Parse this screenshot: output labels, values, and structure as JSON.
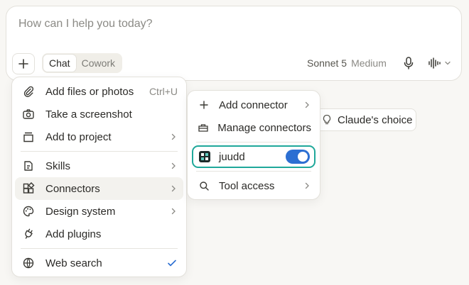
{
  "composer": {
    "placeholder": "How can I help you today?",
    "modes": [
      "Chat",
      "Cowork"
    ],
    "active_mode": "Chat",
    "model_name": "Sonnet 5",
    "model_tier": "Medium"
  },
  "suggestion_chip": {
    "label": "Claude's choice"
  },
  "attach_menu": {
    "items": [
      {
        "label": "Add files or photos",
        "shortcut": "Ctrl+U"
      },
      {
        "label": "Take a screenshot"
      },
      {
        "label": "Add to project"
      },
      {
        "label": "Skills"
      },
      {
        "label": "Connectors"
      },
      {
        "label": "Design system"
      },
      {
        "label": "Add plugins"
      },
      {
        "label": "Web search"
      }
    ]
  },
  "connectors_menu": {
    "add_connector": "Add connector",
    "manage_connectors": "Manage connectors",
    "connector_name": "juudd",
    "connector_enabled": true,
    "tool_access": "Tool access"
  },
  "colors": {
    "accent_teal": "#1fa89a",
    "toggle_blue": "#2c6fd2",
    "check_blue": "#2c6fd2"
  }
}
